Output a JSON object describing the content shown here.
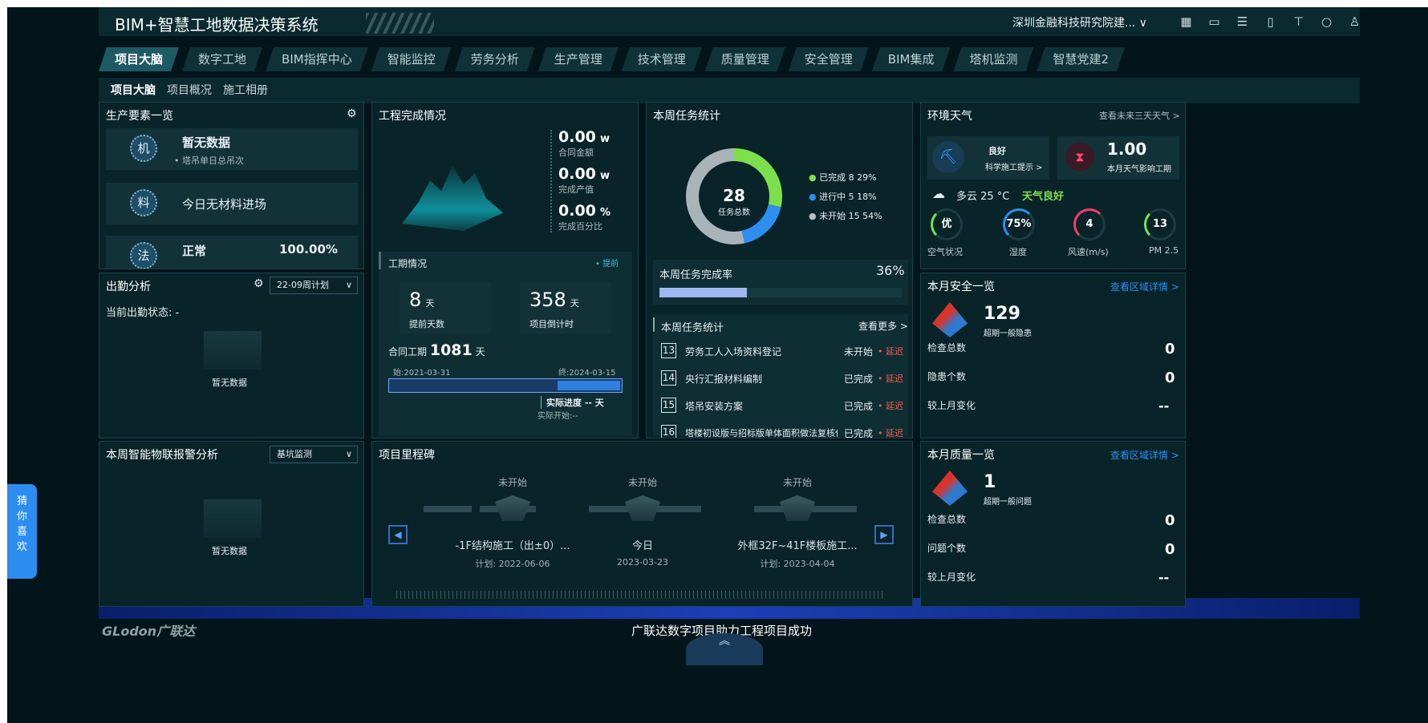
{
  "header": {
    "title": "BIM+智慧工地数据决策系统",
    "org": "深圳金融科技研究院建... ∨",
    "icons": [
      "grid-icon",
      "screen-icon",
      "list-icon",
      "monitor-icon",
      "shirt-icon",
      "refresh-icon",
      "user-icon"
    ]
  },
  "nav": {
    "tabs": [
      "项目大脑",
      "数字工地",
      "BIM指挥中心",
      "智能监控",
      "劳务分析",
      "生产管理",
      "技术管理",
      "质量管理",
      "安全管理",
      "BIM集成",
      "塔机监测",
      "智慧党建2"
    ],
    "subtabs": [
      "项目大脑",
      "项目概况",
      "施工相册"
    ]
  },
  "prod": {
    "title": "生产要素一览",
    "item1_char": "机",
    "item1_title": "暂无数据",
    "item1_sub": "• 塔吊单日总吊次",
    "item2_char": "料",
    "item2_title": "今日无材料进场",
    "item3_char": "法",
    "item3_title": "正常",
    "item3_value": "100.00%"
  },
  "attendance": {
    "title": "出勤分析",
    "select": "22-09周计划",
    "status": "当前出勤状态: -",
    "empty": "暂无数据"
  },
  "iot": {
    "title": "本周智能物联报警分析",
    "select": "基坑监测",
    "empty": "暂无数据"
  },
  "completion": {
    "title": "工程完成情况",
    "contract_value": "0.00",
    "contract_unit": "w",
    "contract_label": "合同金额",
    "output_value": "0.00",
    "output_unit": "w",
    "output_label": "完成产值",
    "percent_value": "0.00",
    "percent_unit": "%",
    "percent_label": "完成百分比",
    "period_title": "工期情况",
    "period_flag": "• 提前",
    "ahead_days": "8",
    "ahead_unit": "天",
    "ahead_label": "提前天数",
    "countdown_days": "358",
    "countdown_unit": "天",
    "countdown_label": "项目倒计时",
    "contract_period_label": "合同工期",
    "contract_period_value": "1081",
    "contract_period_unit": "天",
    "start": "始:2021-03-31",
    "end": "终:2024-03-15",
    "actual_progress": "实际进度 -- 天",
    "actual_start": "实际开始:--"
  },
  "tasks": {
    "title": "本周任务统计",
    "total": "28",
    "total_label": "任务总数",
    "legend": [
      {
        "label": "已完成  8    29%",
        "color": "#7ce04d"
      },
      {
        "label": "进行中  5    18%",
        "color": "#2d8ef0"
      },
      {
        "label": "未开始  15  54%",
        "color": "#b8c2c6"
      }
    ],
    "rate_label": "本周任务完成率",
    "rate_value": "36%",
    "rate_fraction": 0.36,
    "list_title": "本周任务统计",
    "more": "查看更多 >",
    "rows": [
      {
        "no": "13",
        "name": "劳务工人入场资料登记",
        "status": "未开始",
        "flag": "• 延迟"
      },
      {
        "no": "14",
        "name": "央行汇报材料编制",
        "status": "已完成",
        "flag": "• 延迟"
      },
      {
        "no": "15",
        "name": "塔吊安装方案",
        "status": "已完成",
        "flag": "• 延迟"
      },
      {
        "no": "16",
        "name": "塔楼初设版与招标版单体面积做法复核任...",
        "status": "已完成",
        "flag": "• 延迟"
      }
    ]
  },
  "chart_data": {
    "type": "pie",
    "categories": [
      "已完成",
      "进行中",
      "未开始"
    ],
    "values": [
      8,
      5,
      15
    ],
    "percent": [
      29,
      18,
      54
    ],
    "colors": [
      "#7ce04d",
      "#2d8ef0",
      "#a9b4b9"
    ]
  },
  "weather": {
    "title": "环境天气",
    "link": "查看未来三天天气 >",
    "tip_status": "良好",
    "tip_label": "科学施工提示 >",
    "impact_value": "1.00",
    "impact_label": "本月天气影响工期",
    "condition": "多云  25 °C",
    "quality": "天气良好",
    "gauges": [
      {
        "value": "优",
        "label": "空气状况",
        "color": "#7ce04d",
        "level": 0.25
      },
      {
        "value": "75%",
        "label": "湿度",
        "color": "#2d8ef0",
        "level": 0.4
      },
      {
        "value": "4",
        "label": "风速(m/s)",
        "color": "#ff3b6b",
        "level": 0.35
      },
      {
        "value": "13",
        "label": "PM 2.5",
        "color": "#7ce04d",
        "level": 0.2
      }
    ]
  },
  "safety": {
    "title": "本月安全一览",
    "link": "查看区域详情 >",
    "count": "129",
    "count_label": "超期一般隐患",
    "rows": [
      {
        "label": "检查总数",
        "value": "0"
      },
      {
        "label": "隐患个数",
        "value": "0"
      },
      {
        "label": "较上月变化",
        "value": "--"
      }
    ]
  },
  "quality": {
    "title": "本月质量一览",
    "link": "查看区域详情 >",
    "count": "1",
    "count_label": "超期一般问题",
    "rows": [
      {
        "label": "检查总数",
        "value": "0"
      },
      {
        "label": "问题个数",
        "value": "0"
      },
      {
        "label": "较上月变化",
        "value": "--"
      }
    ]
  },
  "milestones": {
    "title": "项目里程碑",
    "items": [
      {
        "status": "未开始",
        "name": "-1F结构施工（出±0）...",
        "plan": "计划:  2022-06-06"
      },
      {
        "status": "未开始",
        "name": "今日",
        "plan": "2023-03-23"
      },
      {
        "status": "未开始",
        "name": "外框32F~41F楼板施工...",
        "plan": "计划:  2023-04-04"
      }
    ]
  },
  "footer": {
    "logo": "GLodon广联达",
    "slogan": "广联达数字项目助力工程项目成功",
    "up": "︽"
  },
  "side": {
    "label": "猜你喜欢"
  }
}
